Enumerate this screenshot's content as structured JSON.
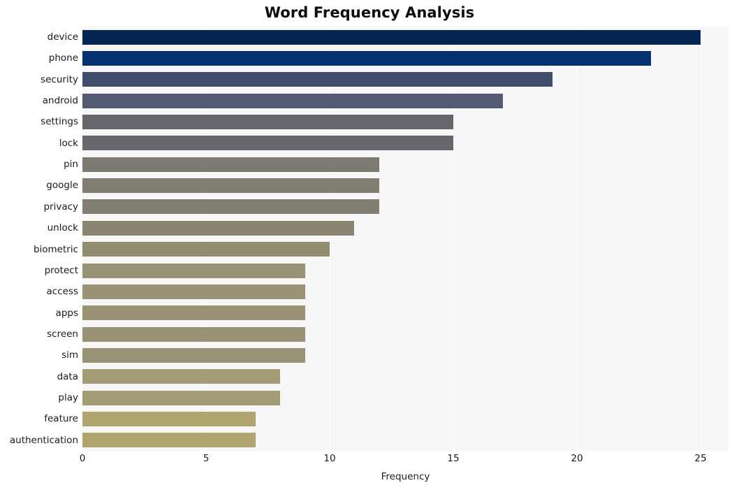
{
  "chart_data": {
    "type": "bar",
    "orientation": "horizontal",
    "title": "Word Frequency Analysis",
    "xlabel": "Frequency",
    "ylabel": "",
    "categories": [
      "device",
      "phone",
      "security",
      "android",
      "settings",
      "lock",
      "pin",
      "google",
      "privacy",
      "unlock",
      "biometric",
      "protect",
      "access",
      "apps",
      "screen",
      "sim",
      "data",
      "play",
      "feature",
      "authentication"
    ],
    "values": [
      25,
      23,
      19,
      17,
      15,
      15,
      12,
      12,
      12,
      11,
      10,
      9,
      9,
      9,
      9,
      9,
      8,
      8,
      7,
      7
    ],
    "bar_colors": [
      "#042552",
      "#04306e",
      "#3f4c6b",
      "#545a71",
      "#66676d",
      "#66676d",
      "#7d7a72",
      "#817d73",
      "#827e73",
      "#8b8672",
      "#918b72",
      "#9a9275",
      "#9a9275",
      "#9a9275",
      "#9a9275",
      "#9a9275",
      "#a39a76",
      "#a39a76",
      "#b0a46f",
      "#b0a46f"
    ],
    "xlim": [
      0,
      26.13
    ],
    "xticks": [
      0,
      5,
      10,
      15,
      20,
      25
    ],
    "xtick_labels": [
      "0",
      "5",
      "10",
      "15",
      "20",
      "25"
    ],
    "grid": true,
    "grid_axis": "x",
    "grid_color": "#ffffff",
    "legend": null,
    "plot_background": "#f7f7f7",
    "figure_background": "#ffffff"
  }
}
